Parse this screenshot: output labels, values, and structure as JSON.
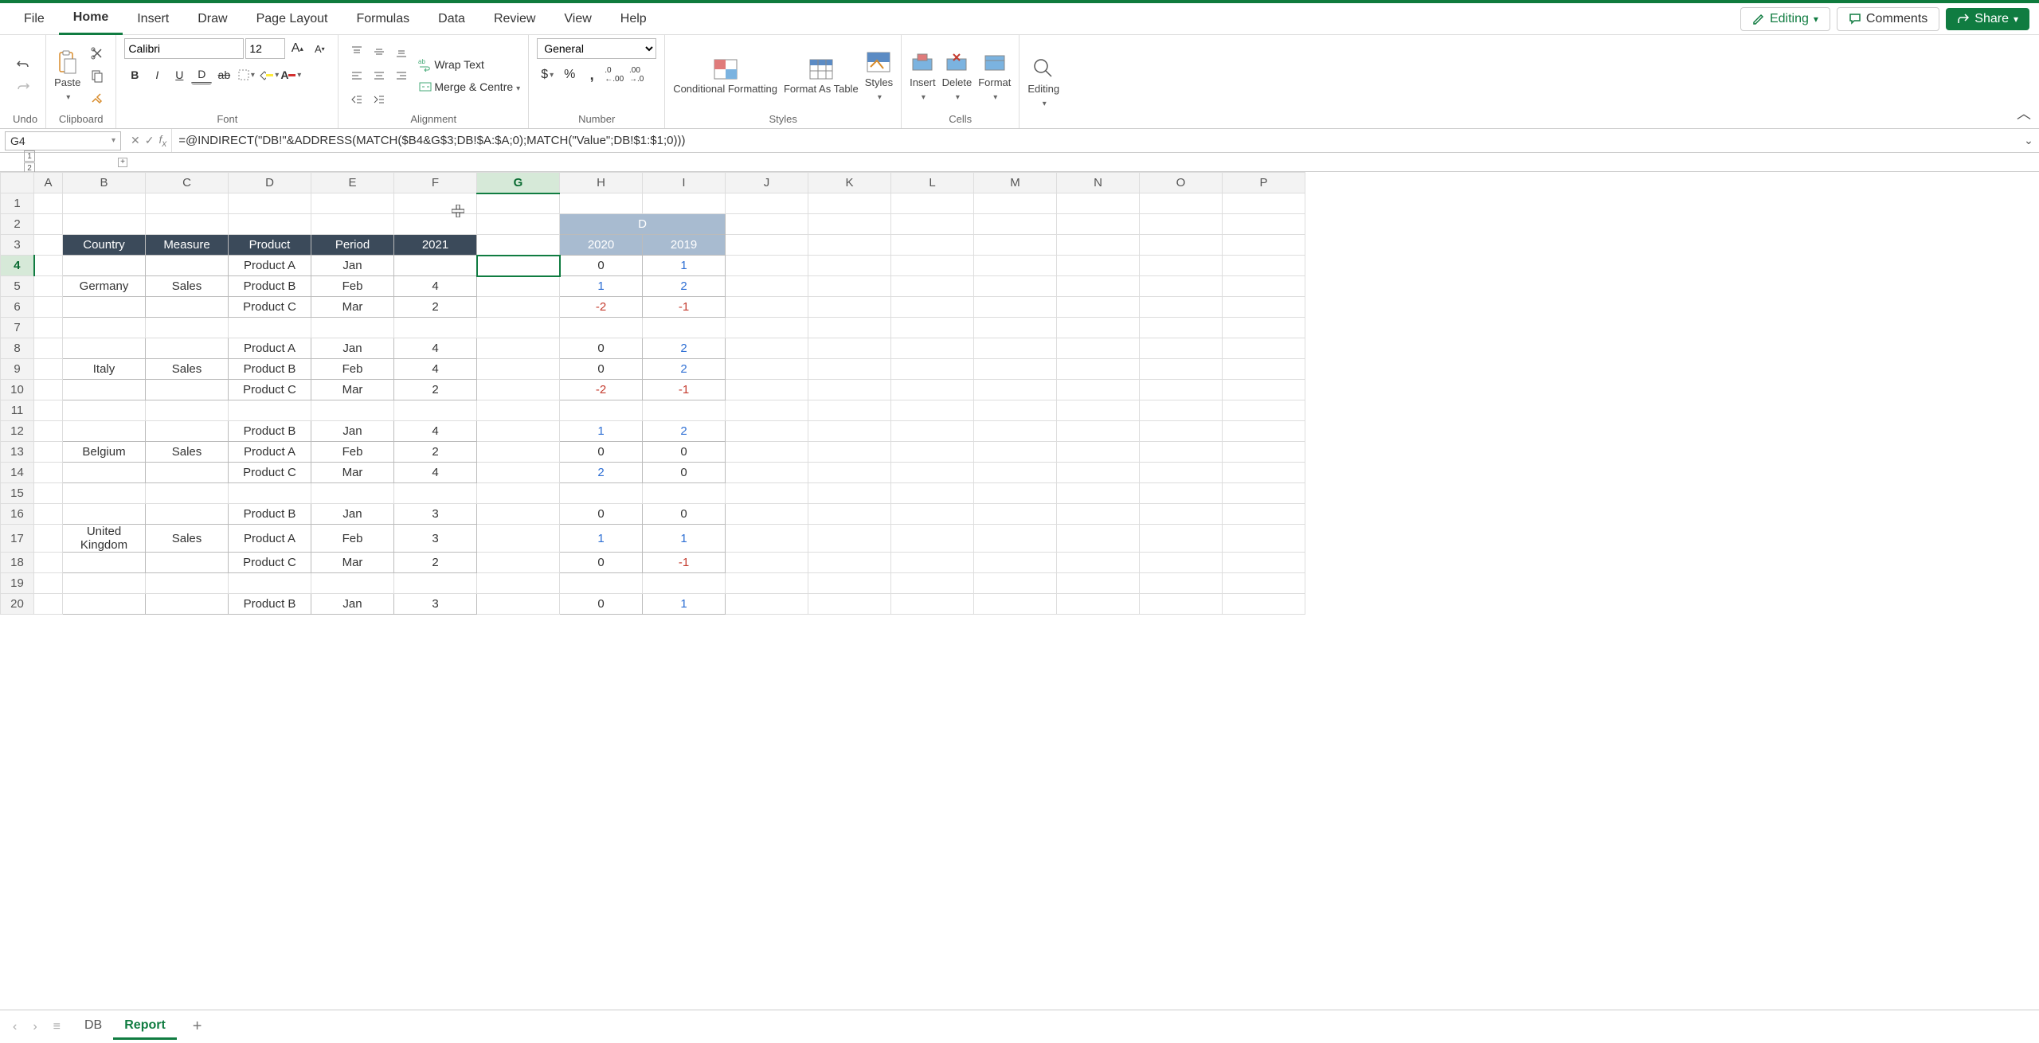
{
  "menu": {
    "tabs": [
      "File",
      "Home",
      "Insert",
      "Draw",
      "Page Layout",
      "Formulas",
      "Data",
      "Review",
      "View",
      "Help"
    ],
    "active": "Home",
    "editing": "Editing",
    "comments": "Comments",
    "share": "Share"
  },
  "ribbon": {
    "undo_label": "Undo",
    "clipboard_label": "Clipboard",
    "paste": "Paste",
    "font_label": "Font",
    "font_name": "Calibri",
    "font_size": "12",
    "alignment_label": "Alignment",
    "wrap_text": "Wrap Text",
    "merge_centre": "Merge & Centre",
    "number_label": "Number",
    "number_format": "General",
    "styles_label": "Styles",
    "cond_fmt": "Conditional Formatting",
    "fmt_table": "Format As Table",
    "styles": "Styles",
    "cells_label": "Cells",
    "insert": "Insert",
    "delete": "Delete",
    "format": "Format",
    "editing_label": "Editing",
    "editing": "Editing"
  },
  "formula": {
    "name_box": "G4",
    "formula": "=@INDIRECT(\"DB!\"&ADDRESS(MATCH($B4&G$3;DB!$A:$A;0);MATCH(\"Value\";DB!$1:$1;0)))"
  },
  "columns": [
    "A",
    "B",
    "C",
    "D",
    "E",
    "F",
    "G",
    "H",
    "I",
    "J",
    "K",
    "L",
    "M",
    "N",
    "O",
    "P"
  ],
  "active_col": "G",
  "active_row": 4,
  "row_count": 20,
  "outline": {
    "levels": [
      "1",
      "2"
    ],
    "plus": "+"
  },
  "table": {
    "group_header": "D",
    "headers": [
      "Country",
      "Measure",
      "Product",
      "Period",
      "2021",
      "2020",
      "2019"
    ],
    "blocks": [
      {
        "country": "Germany",
        "measure": "Sales",
        "rows": [
          {
            "product": "Product A",
            "period": "Jan",
            "y2021": "",
            "y2020": "0",
            "y2019": "1",
            "c2020": "",
            "c2019": "pos"
          },
          {
            "product": "Product B",
            "period": "Feb",
            "y2021": "4",
            "y2020": "1",
            "y2019": "2",
            "c2020": "pos",
            "c2019": "pos"
          },
          {
            "product": "Product C",
            "period": "Mar",
            "y2021": "2",
            "y2020": "-2",
            "y2019": "-1",
            "c2020": "neg",
            "c2019": "neg"
          }
        ]
      },
      {
        "country": "Italy",
        "measure": "Sales",
        "rows": [
          {
            "product": "Product A",
            "period": "Jan",
            "y2021": "4",
            "y2020": "0",
            "y2019": "2",
            "c2020": "",
            "c2019": "pos"
          },
          {
            "product": "Product B",
            "period": "Feb",
            "y2021": "4",
            "y2020": "0",
            "y2019": "2",
            "c2020": "",
            "c2019": "pos"
          },
          {
            "product": "Product C",
            "period": "Mar",
            "y2021": "2",
            "y2020": "-2",
            "y2019": "-1",
            "c2020": "neg",
            "c2019": "neg"
          }
        ]
      },
      {
        "country": "Belgium",
        "measure": "Sales",
        "rows": [
          {
            "product": "Product B",
            "period": "Jan",
            "y2021": "4",
            "y2020": "1",
            "y2019": "2",
            "c2020": "pos",
            "c2019": "pos"
          },
          {
            "product": "Product A",
            "period": "Feb",
            "y2021": "2",
            "y2020": "0",
            "y2019": "0",
            "c2020": "",
            "c2019": ""
          },
          {
            "product": "Product C",
            "period": "Mar",
            "y2021": "4",
            "y2020": "2",
            "y2019": "0",
            "c2020": "pos",
            "c2019": ""
          }
        ]
      },
      {
        "country": "United Kingdom",
        "measure": "Sales",
        "rows": [
          {
            "product": "Product B",
            "period": "Jan",
            "y2021": "3",
            "y2020": "0",
            "y2019": "0",
            "c2020": "",
            "c2019": ""
          },
          {
            "product": "Product A",
            "period": "Feb",
            "y2021": "3",
            "y2020": "1",
            "y2019": "1",
            "c2020": "pos",
            "c2019": "pos"
          },
          {
            "product": "Product C",
            "period": "Mar",
            "y2021": "2",
            "y2020": "0",
            "y2019": "-1",
            "c2020": "",
            "c2019": "neg"
          }
        ]
      },
      {
        "country": "",
        "measure": "",
        "rows": [
          {
            "product": "Product B",
            "period": "Jan",
            "y2021": "3",
            "y2020": "0",
            "y2019": "1",
            "c2020": "",
            "c2019": "pos"
          }
        ]
      }
    ]
  },
  "sheets": {
    "tabs": [
      "DB",
      "Report"
    ],
    "active": "Report"
  }
}
